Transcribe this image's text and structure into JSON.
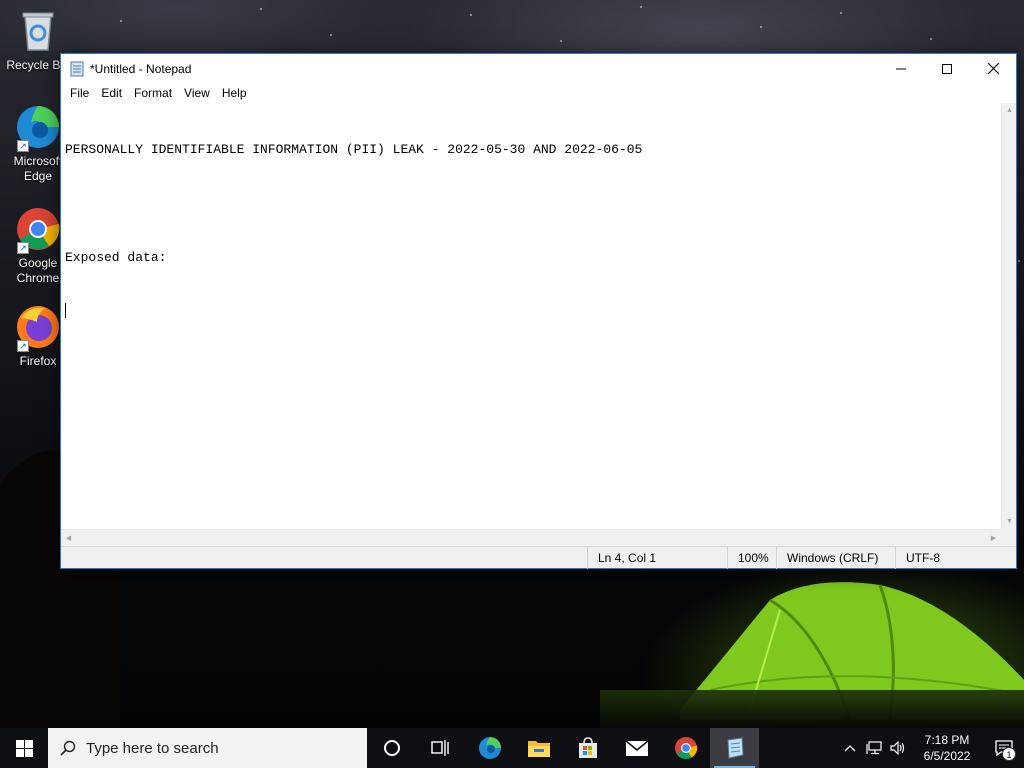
{
  "desktop": {
    "icons": [
      {
        "label": "Recycle Bin",
        "icon": "recycle-bin-icon"
      },
      {
        "label": "Microsoft Edge",
        "icon": "edge-icon"
      },
      {
        "label": "Google Chrome",
        "icon": "chrome-icon"
      },
      {
        "label": "Firefox",
        "icon": "firefox-icon"
      }
    ]
  },
  "notepad": {
    "title": "*Untitled - Notepad",
    "caption_buttons": {
      "minimize": "—",
      "maximize": "☐",
      "close": "✕"
    },
    "menu": [
      "File",
      "Edit",
      "Format",
      "View",
      "Help"
    ],
    "content_lines": [
      "PERSONALLY IDENTIFIABLE INFORMATION (PII) LEAK - 2022-05-30 AND 2022-06-05",
      "",
      "Exposed data:",
      ""
    ],
    "status": {
      "position": "Ln 4, Col 1",
      "zoom": "100%",
      "line_ending": "Windows (CRLF)",
      "encoding": "UTF-8"
    }
  },
  "taskbar": {
    "search_placeholder": "Type here to search",
    "pinned": [
      {
        "name": "cortana",
        "icon": "cortana-circle-icon"
      },
      {
        "name": "task-view",
        "icon": "task-view-icon"
      },
      {
        "name": "edge",
        "icon": "edge-icon"
      },
      {
        "name": "file-explorer",
        "icon": "folder-icon"
      },
      {
        "name": "store",
        "icon": "store-bag-icon"
      },
      {
        "name": "mail",
        "icon": "mail-icon"
      },
      {
        "name": "chrome",
        "icon": "chrome-icon"
      },
      {
        "name": "notepad",
        "icon": "notepad-icon",
        "active": true
      }
    ],
    "clock": {
      "time": "7:18 PM",
      "date": "6/5/2022"
    },
    "notification_count": "1"
  },
  "colors": {
    "accent": "#76b9ed",
    "window_border": "#2b78c7",
    "taskbar": "#0e0f12",
    "tent": "#8fd12a"
  }
}
